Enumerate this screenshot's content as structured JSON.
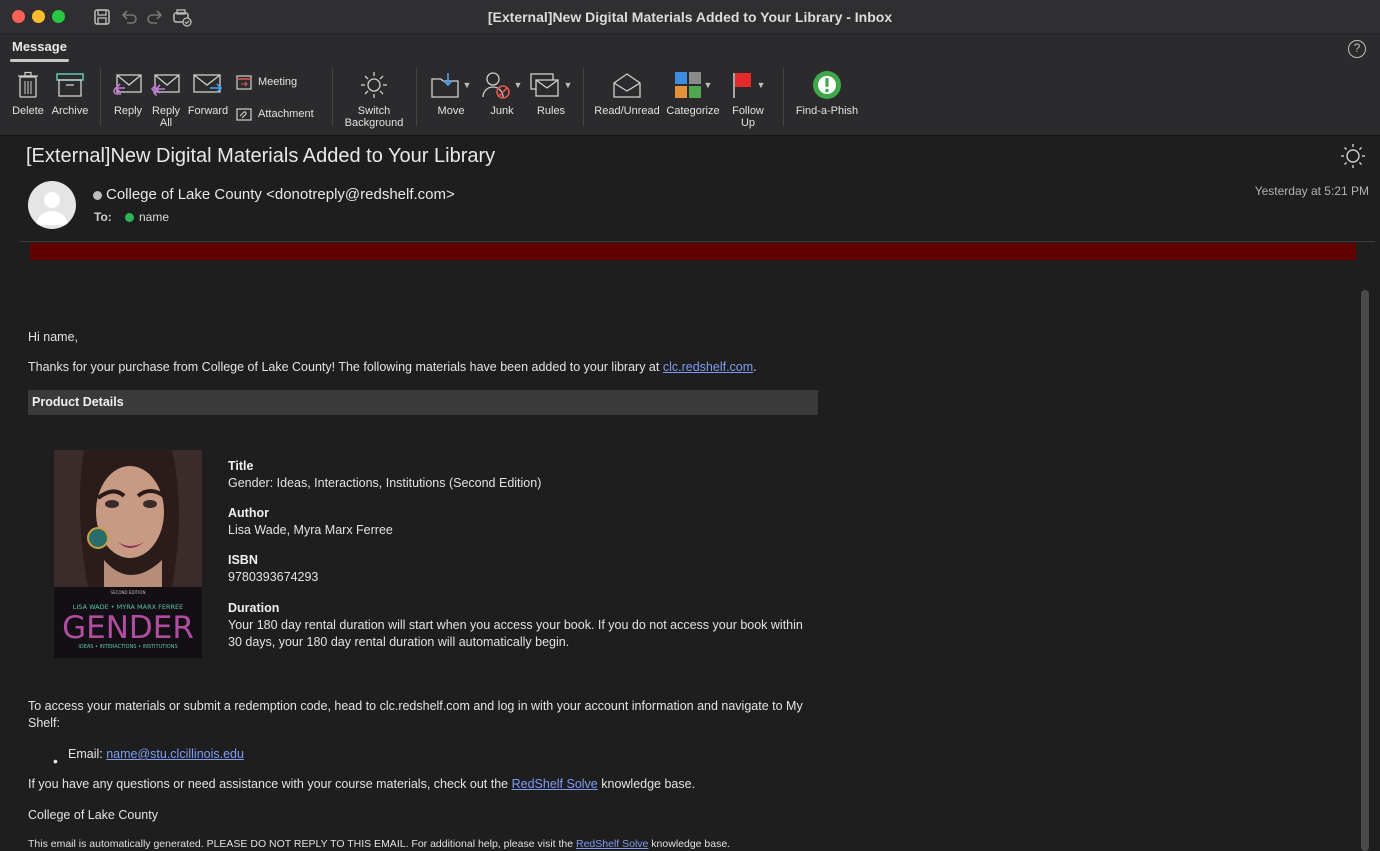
{
  "window": {
    "title": "[External]New Digital Materials Added to Your Library - Inbox"
  },
  "ribbon": {
    "tab": "Message",
    "buttons": {
      "delete": "Delete",
      "archive": "Archive",
      "reply": "Reply",
      "reply_all_1": "Reply",
      "reply_all_2": "All",
      "forward": "Forward",
      "meeting": "Meeting",
      "attachment": "Attachment",
      "switch_bg_1": "Switch",
      "switch_bg_2": "Background",
      "move": "Move",
      "junk": "Junk",
      "rules": "Rules",
      "read_unread": "Read/Unread",
      "categorize": "Categorize",
      "follow_up_1": "Follow",
      "follow_up_2": "Up",
      "find_a_phish": "Find-a-Phish"
    },
    "help": "?"
  },
  "header": {
    "subject": "[External]New Digital Materials Added to Your Library",
    "sender": "College of Lake County <donotreply@redshelf.com>",
    "to_label": "To:",
    "to_name": "name",
    "date": "Yesterday at 5:21 PM"
  },
  "body": {
    "greeting": "Hi name,",
    "intro": "Thanks for your purchase from College of Lake County! The following materials have been added to your library at ",
    "intro_link": "clc.redshelf.com",
    "intro_end": ".",
    "product_details": "Product Details",
    "cover": {
      "edition": "SECOND EDITION",
      "authors": "LISA WADE • MYRA MARX FERREE",
      "title": "GENDER",
      "subtitle": "IDEAS • INTERACTIONS • INSTITUTIONS"
    },
    "details": {
      "title_label": "Title",
      "title_value": "Gender: Ideas, Interactions, Institutions (Second Edition)",
      "author_label": "Author",
      "author_value": "Lisa Wade, Myra Marx Ferree",
      "isbn_label": "ISBN",
      "isbn_value": "9780393674293",
      "duration_label": "Duration",
      "duration_line1": "Your 180 day rental duration will start when you access your book. If you do not access your book within",
      "duration_line2": "30 days, your 180 day rental duration will automatically begin."
    },
    "access_line1": "To access your materials or submit a redemption code, head to clc.redshelf.com and log in with your account information and navigate to My",
    "access_line2": "Shelf:",
    "email_label": "Email: ",
    "email_link": "name@stu.clcillinois.edu",
    "questions": "If you have any questions or need assistance with your course materials, check out the ",
    "solve_link": "RedShelf Solve",
    "questions_end": " knowledge base.",
    "signature": "College of Lake County",
    "footer": "This email is automatically generated. PLEASE DO NOT REPLY TO THIS EMAIL. For additional help, please visit the ",
    "footer_link": "RedShelf Solve",
    "footer_end": " knowledge base."
  }
}
